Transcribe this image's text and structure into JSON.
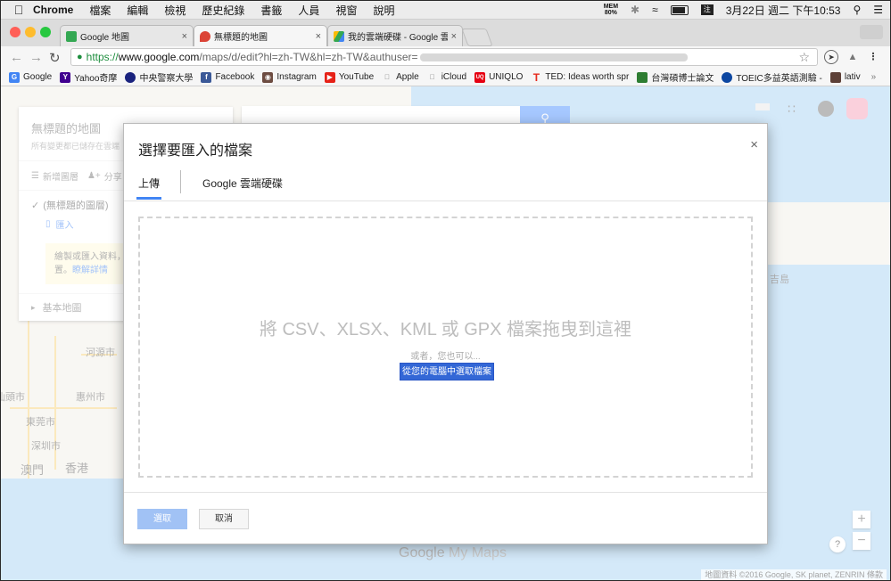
{
  "menubar": {
    "app_name": "Chrome",
    "items": [
      "檔案",
      "編輯",
      "檢視",
      "歷史紀錄",
      "書籤",
      "人員",
      "視窗",
      "說明"
    ],
    "mem_label": "MEM",
    "mem_value": "80%",
    "ime_label": "注",
    "clock": "3月22日 週二 下午10:53"
  },
  "tabs": [
    {
      "title": "Google 地圖",
      "color": "#34a853"
    },
    {
      "title": "無標題的地圖",
      "color": "#db4437"
    },
    {
      "title": "我的雲端硬碟 - Google 雲端",
      "color": "#fbbc05"
    }
  ],
  "omnibox": {
    "scheme": "https://",
    "host": "www.google.com",
    "path": "/maps/d/edit?hl=zh-TW&hl=zh-TW&authuser="
  },
  "bookmarks": [
    {
      "label": "Google",
      "icon": "google-icon",
      "color": "#4285f4"
    },
    {
      "label": "Yahoo奇摩",
      "icon": "yahoo-icon",
      "color": "#400090"
    },
    {
      "label": "中央警察大學",
      "icon": "police-icon",
      "color": "#1a237e"
    },
    {
      "label": "Facebook",
      "icon": "facebook-icon",
      "color": "#3b5998"
    },
    {
      "label": "Instagram",
      "icon": "instagram-icon",
      "color": "#6d4c41"
    },
    {
      "label": "YouTube",
      "icon": "youtube-icon",
      "color": "#e62117"
    },
    {
      "label": "Apple",
      "icon": "apple-icon",
      "color": "#777777"
    },
    {
      "label": "iCloud",
      "icon": "apple-icon",
      "color": "#777777"
    },
    {
      "label": "UNIQLO",
      "icon": "uniqlo-icon",
      "color": "#e60012"
    },
    {
      "label": "TED: Ideas worth spr",
      "icon": "ted-icon",
      "color": "#e62b1e"
    },
    {
      "label": "台灣碩博士論文",
      "icon": "thesis-icon",
      "color": "#2e7d32"
    },
    {
      "label": "TOEIC多益英語測驗 -",
      "icon": "toeic-icon",
      "color": "#0d47a1"
    },
    {
      "label": "lativ",
      "icon": "lativ-icon",
      "color": "#5d4037"
    }
  ],
  "map_panel": {
    "title": "無標題的地圖",
    "saved_text": "所有變更都已儲存在雲端",
    "add_layer": "新增圖層",
    "share": "分享",
    "layer_name": "(無標題的圖層)",
    "import_link": "匯入",
    "hint_text": "繪製或匯入資料，",
    "hint_text2": "置。",
    "learn_more": "瞭解詳情",
    "base_map": "基本地圖"
  },
  "map_labels": {
    "city1": "河源市",
    "city2": "惠州市",
    "city3": "東莞市",
    "city4": "深圳市",
    "city5": "澳門",
    "city6": "香港",
    "city7": "汕頭市",
    "city8": "吉島"
  },
  "map_footer": {
    "brand_google": "Google",
    "brand_mymaps": "My Maps",
    "attribution": "地圖資料 ©2016 Google, SK planet, ZENRIN",
    "terms": "條款",
    "help": "?",
    "zoom_in": "+",
    "zoom_out": "−"
  },
  "dialog": {
    "title": "選擇要匯入的檔案",
    "close": "×",
    "tab_upload": "上傳",
    "tab_drive": "Google 雲端硬碟",
    "drop_text": "將 CSV、XLSX、KML 或 GPX 檔案拖曳到這裡",
    "or_text": "或者，您也可以...",
    "choose_button": "從您的電腦中選取檔案",
    "select_button": "選取",
    "cancel_button": "取消"
  },
  "colors": {
    "accent": "#4285f4",
    "primary_button": "#3367d6",
    "disabled_button": "#a1c2f5",
    "map_water": "#a9d2f2"
  }
}
